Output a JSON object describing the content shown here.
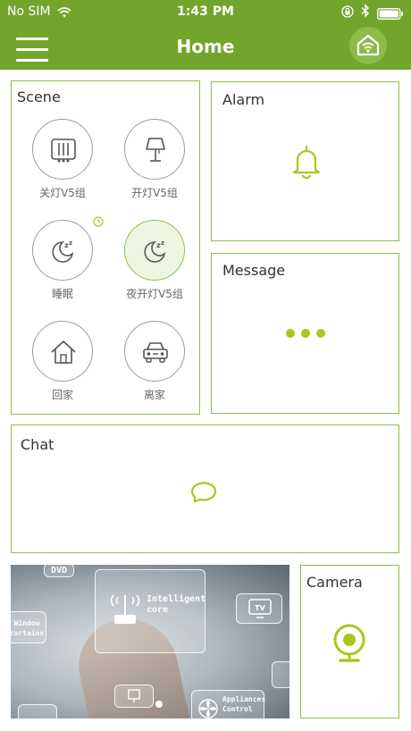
{
  "status_bar": {
    "carrier": "No SIM",
    "time": "1:43 PM"
  },
  "nav": {
    "title": "Home"
  },
  "scene": {
    "title": "Scene",
    "items": [
      {
        "label": "关灯V5组",
        "icon": "light-switch-icon"
      },
      {
        "label": "开灯V5组",
        "icon": "lamp-icon"
      },
      {
        "label": "睡眠",
        "icon": "moon-sleep-icon"
      },
      {
        "label": "夜开灯V5组",
        "icon": "moon-sleep-icon",
        "active": true
      },
      {
        "label": "回家",
        "icon": "house-icon"
      },
      {
        "label": "离家",
        "icon": "car-icon"
      }
    ]
  },
  "alarm": {
    "title": "Alarm",
    "icon": "bell-icon"
  },
  "message": {
    "title": "Message",
    "icon": "ellipsis-icon"
  },
  "chat": {
    "title": "Chat",
    "icon": "chat-bubble-icon"
  },
  "camera": {
    "title": "Camera",
    "icon": "webcam-icon"
  },
  "banner": {
    "tiles": [
      "DVD",
      "Intelligent core",
      "TV",
      "Window curtains",
      "Appliances Control"
    ]
  },
  "colors": {
    "brand_green": "#73a52c",
    "accent_lime": "#a8c81e",
    "card_border": "#8fbf49"
  }
}
